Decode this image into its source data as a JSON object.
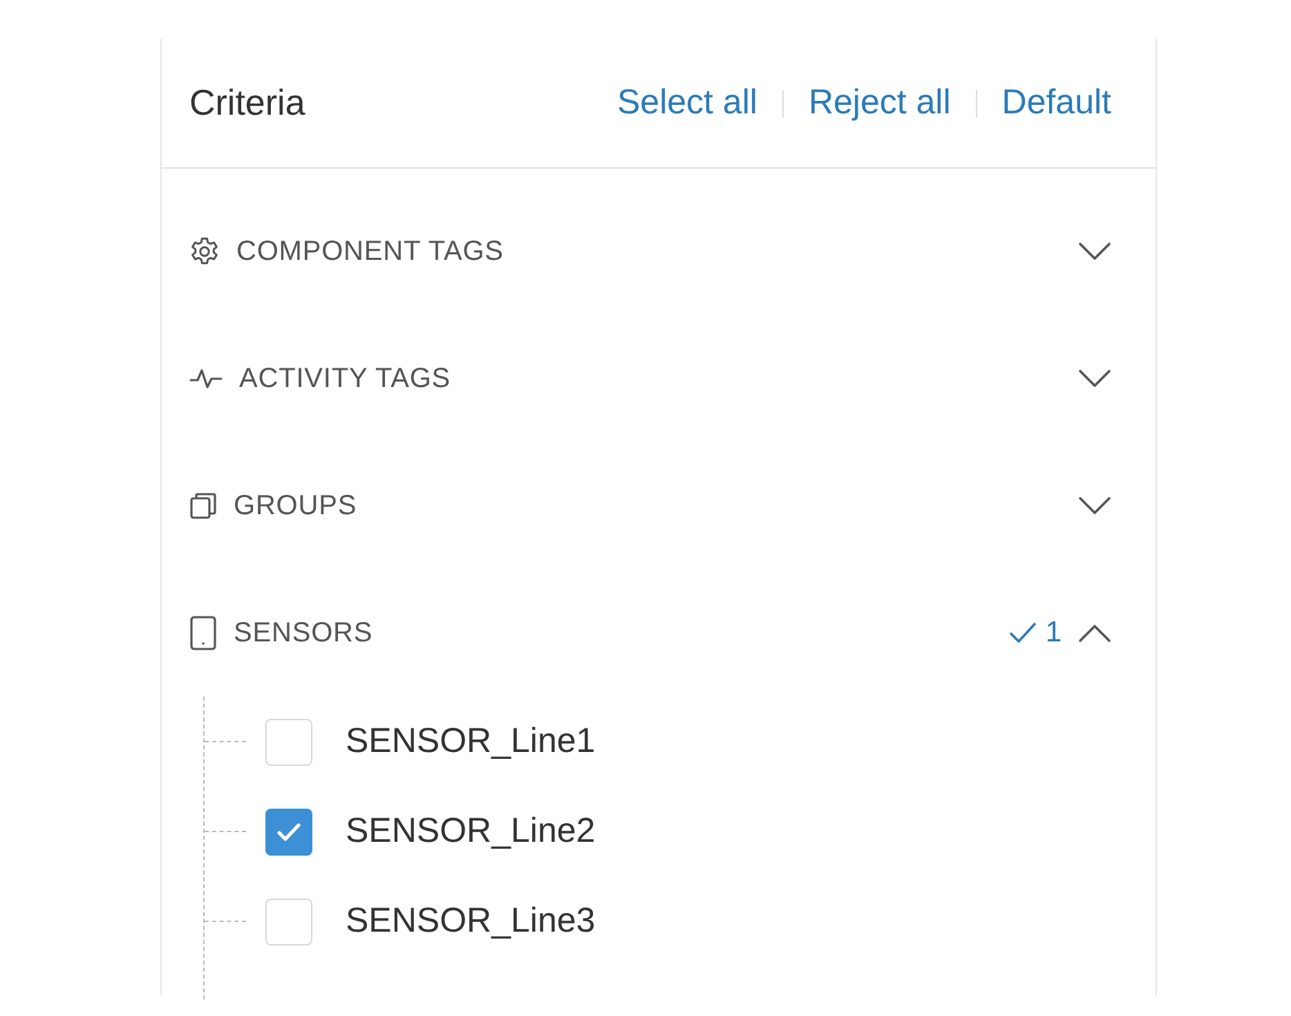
{
  "panel": {
    "title": "Criteria",
    "actions": [
      "Select all",
      "Reject all",
      "Default"
    ]
  },
  "sections": [
    {
      "label": "COMPONENT TAGS",
      "expanded": false
    },
    {
      "label": "ACTIVITY TAGS",
      "expanded": false
    },
    {
      "label": "GROUPS",
      "expanded": false
    },
    {
      "label": "SENSORS",
      "expanded": true,
      "selected_count": "1",
      "items": [
        {
          "label": "SENSOR_Line1",
          "checked": false
        },
        {
          "label": "SENSOR_Line2",
          "checked": true
        },
        {
          "label": "SENSOR_Line3",
          "checked": false
        }
      ]
    }
  ]
}
